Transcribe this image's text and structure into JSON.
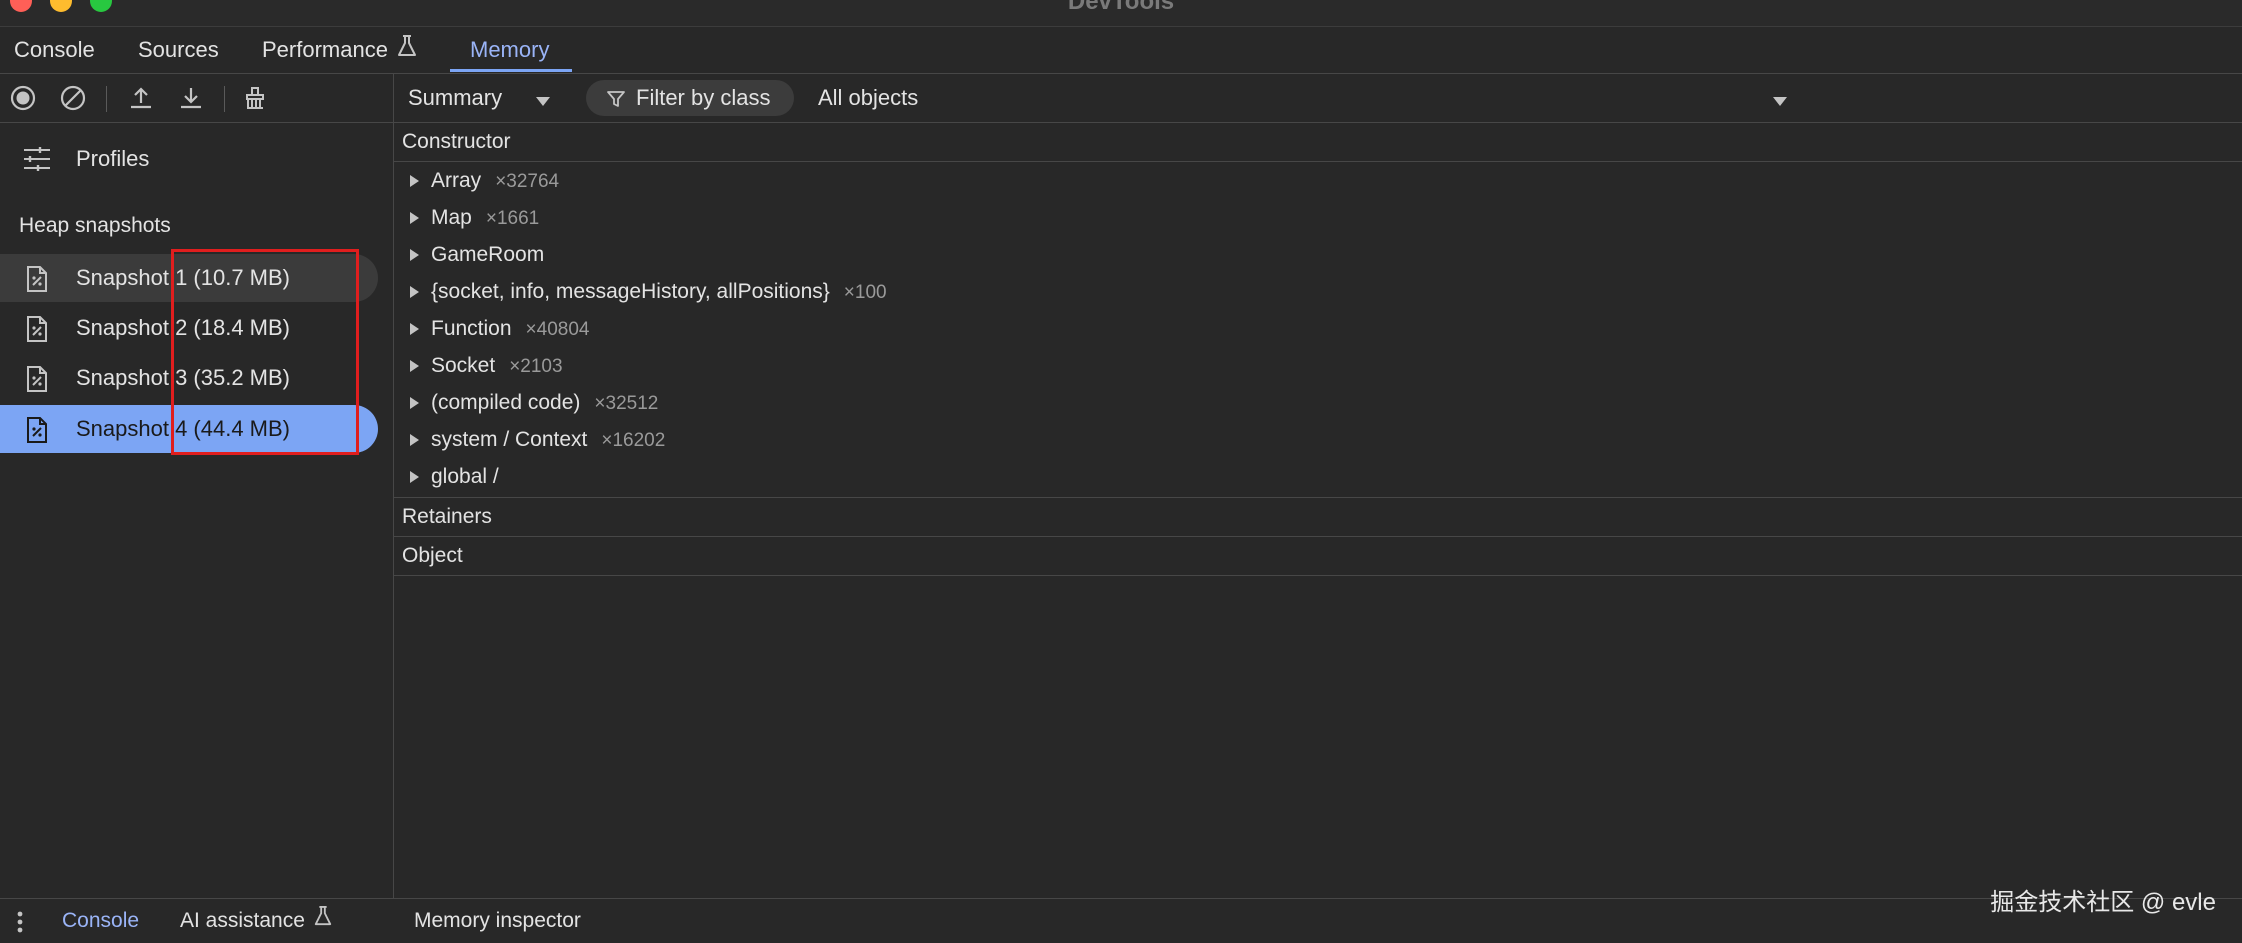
{
  "window": {
    "title": "DevTools",
    "traffic_lights": [
      "#ff5f57",
      "#febc2e",
      "#28c840"
    ]
  },
  "tabs": [
    {
      "label": "Console"
    },
    {
      "label": "Sources"
    },
    {
      "label": "Performance"
    },
    {
      "label": "Memory",
      "active": true
    }
  ],
  "toolbar": {
    "icons": [
      "record-icon",
      "clear-icon",
      "load-profile-icon",
      "save-profile-icon",
      "collect-garbage-icon"
    ]
  },
  "sidebar": {
    "profiles_label": "Profiles",
    "section_heading": "Heap snapshots",
    "snapshots": [
      {
        "label": "Snapshot 1 (10.7 MB)",
        "state": "hover"
      },
      {
        "label": "Snapshot 2 (18.4 MB)",
        "state": "normal"
      },
      {
        "label": "Snapshot 3 (35.2 MB)",
        "state": "normal"
      },
      {
        "label": "Snapshot 4 (44.4 MB)",
        "state": "selected"
      }
    ]
  },
  "view_toolbar": {
    "view_select": "Summary",
    "filter_placeholder": "Filter by class",
    "objects_select": "All objects"
  },
  "grid": {
    "constructor_header": "Constructor",
    "rows": [
      {
        "name": "Array",
        "count": "×32764"
      },
      {
        "name": "Map",
        "count": "×1661"
      },
      {
        "name": "GameRoom",
        "count": ""
      },
      {
        "name": "{socket, info, messageHistory, allPositions}",
        "count": "×100"
      },
      {
        "name": "Function",
        "count": "×40804"
      },
      {
        "name": "Socket",
        "count": "×2103"
      },
      {
        "name": "(compiled code)",
        "count": "×32512"
      },
      {
        "name": "system / Context",
        "count": "×16202"
      },
      {
        "name": "global /",
        "count": ""
      }
    ],
    "retainers_header": "Retainers",
    "object_header": "Object"
  },
  "drawer": {
    "tabs": [
      {
        "label": "Console",
        "active": true
      },
      {
        "label": "AI assistance"
      },
      {
        "label": "Memory inspector"
      }
    ]
  },
  "watermark": "掘金技术社区 @ evle",
  "colors": {
    "accent": "#7ca5f4",
    "annotation_box": "#e01e1e"
  }
}
